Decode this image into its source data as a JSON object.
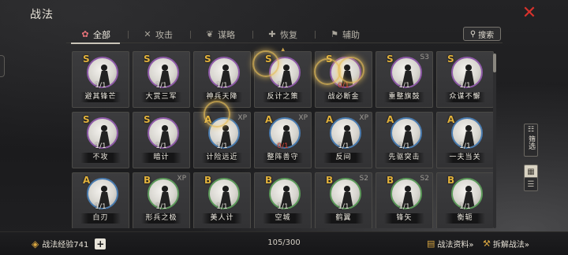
{
  "header": {
    "title": "战法",
    "close_icon": "close-icon"
  },
  "tabs": [
    {
      "label": "全部",
      "icon": "all-icon",
      "glyph": "✿",
      "active": true
    },
    {
      "label": "攻击",
      "icon": "swords-icon",
      "glyph": "✕",
      "active": false
    },
    {
      "label": "谋略",
      "icon": "scroll-icon",
      "glyph": "❦",
      "active": false
    },
    {
      "label": "恢复",
      "icon": "heal-icon",
      "glyph": "✚",
      "active": false
    },
    {
      "label": "辅助",
      "icon": "flag-icon",
      "glyph": "⚑",
      "active": false
    }
  ],
  "search": {
    "label": "搜索",
    "icon": "search-icon"
  },
  "cards": [
    {
      "grade": "S",
      "tag": "",
      "count": "1/1",
      "count_red": false,
      "name": "避其锋芒",
      "frame": "S"
    },
    {
      "grade": "S",
      "tag": "",
      "count": "1/1",
      "count_red": false,
      "name": "大赏三军",
      "frame": "S"
    },
    {
      "grade": "S",
      "tag": "",
      "count": "1/1",
      "count_red": false,
      "name": "神兵天降",
      "frame": "S"
    },
    {
      "grade": "S",
      "tag": "",
      "count": "1/1",
      "count_red": false,
      "name": "反计之策",
      "frame": "S"
    },
    {
      "grade": "S",
      "tag": "",
      "count": "0/1",
      "count_red": true,
      "name": "战必断金",
      "frame": "S"
    },
    {
      "grade": "S",
      "tag": "S3",
      "count": "1/1",
      "count_red": false,
      "name": "重整旗鼓",
      "frame": "S"
    },
    {
      "grade": "S",
      "tag": "",
      "count": "1/1",
      "count_red": false,
      "name": "众谋不懈",
      "frame": "S"
    },
    {
      "grade": "S",
      "tag": "",
      "count": "1/1",
      "count_red": false,
      "name": "不攻",
      "frame": "S"
    },
    {
      "grade": "S",
      "tag": "",
      "count": "1/1",
      "count_red": false,
      "name": "暗计",
      "frame": "S"
    },
    {
      "grade": "A",
      "tag": "XP",
      "count": "1/1",
      "count_red": false,
      "name": "计险远近",
      "frame": "A"
    },
    {
      "grade": "A",
      "tag": "XP",
      "count": "0/1",
      "count_red": true,
      "name": "整阵善守",
      "frame": "A"
    },
    {
      "grade": "A",
      "tag": "XP",
      "count": "1/1",
      "count_red": false,
      "name": "反间",
      "frame": "A"
    },
    {
      "grade": "A",
      "tag": "",
      "count": "1/1",
      "count_red": false,
      "name": "先驱突击",
      "frame": "A"
    },
    {
      "grade": "A",
      "tag": "",
      "count": "1/1",
      "count_red": false,
      "name": "一夫当关",
      "frame": "A"
    },
    {
      "grade": "A",
      "tag": "",
      "count": "1/1",
      "count_red": false,
      "name": "白刃",
      "frame": "A"
    },
    {
      "grade": "B",
      "tag": "XP",
      "count": "1/1",
      "count_red": false,
      "name": "形兵之极",
      "frame": "B"
    },
    {
      "grade": "B",
      "tag": "",
      "count": "1/1",
      "count_red": false,
      "name": "美人计",
      "frame": "B"
    },
    {
      "grade": "B",
      "tag": "",
      "count": "1/1",
      "count_red": false,
      "name": "空城",
      "frame": "B"
    },
    {
      "grade": "B",
      "tag": "S2",
      "count": "1/1",
      "count_red": false,
      "name": "鹤翼",
      "frame": "B"
    },
    {
      "grade": "B",
      "tag": "S2",
      "count": "1/1",
      "count_red": false,
      "name": "锋矢",
      "frame": "B"
    },
    {
      "grade": "B",
      "tag": "",
      "count": "1/1",
      "count_red": false,
      "name": "衡轭",
      "frame": "B"
    }
  ],
  "side": {
    "filter_label": "筛选",
    "filter_icon": "filter-icon",
    "grid_icon": "grid-view-icon",
    "list_icon": "list-view-icon"
  },
  "footer": {
    "exp_label": "战法经验741",
    "exp_icon": "book-icon",
    "plus_label": "+",
    "capacity": "105/300",
    "info_label": "战法资料»",
    "info_icon": "info-book-icon",
    "decompose_label": "拆解战法»",
    "decompose_icon": "decompose-icon"
  },
  "colors": {
    "close": "#d8322c",
    "grade_gold": "#e2b23c",
    "count_red": "#e24b3f",
    "frame_S": "#8e5aa8",
    "frame_A": "#4a7cb0",
    "frame_B": "#5c9a5a"
  }
}
